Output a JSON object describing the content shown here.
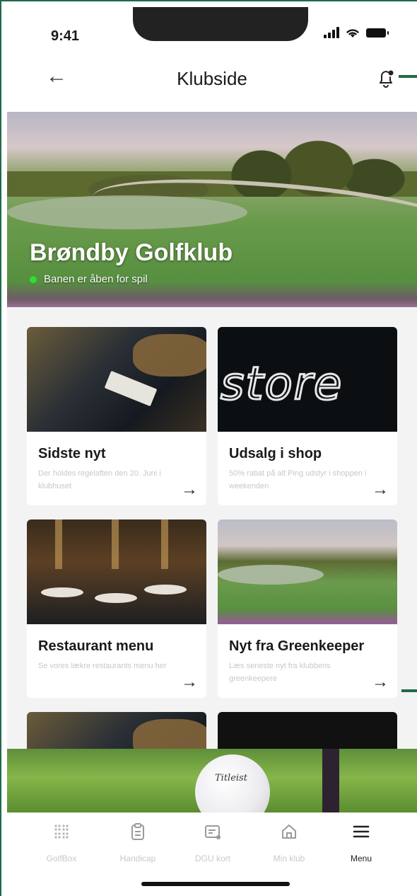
{
  "status_bar": {
    "time": "9:41"
  },
  "header": {
    "title": "Klubside",
    "back_icon": "arrow-left-icon",
    "notification_icon": "bell-icon"
  },
  "hero": {
    "club_name": "Brøndby Golfklub",
    "status_text": "Banen er åben for spil",
    "status_color": "#2ee02a"
  },
  "cards": [
    {
      "title": "Sidste nyt",
      "description": "Der holdes regelaften den 20. Juni i klubhuset",
      "arrow": "→"
    },
    {
      "title": "Udsalg i shop",
      "description": "50% rabat på alt Ping udstyr i shoppen i weekenden",
      "image_text": "store",
      "arrow": "→"
    },
    {
      "title": "Restaurant menu",
      "description": "Se vores lækre restaurants menu her",
      "arrow": "→"
    },
    {
      "title": "Nyt fra Greenkeeper",
      "description": "Læs seneste nyt fra klubbens greenkeepere",
      "arrow": "→"
    }
  ],
  "banner": {
    "ball_brand": "Titleist"
  },
  "nav": {
    "items": [
      {
        "label": "GolfBox",
        "icon": "grid-icon"
      },
      {
        "label": "Handicap",
        "icon": "clipboard-icon"
      },
      {
        "label": "DGU kort",
        "icon": "card-icon"
      },
      {
        "label": "Min klub",
        "icon": "home-icon"
      },
      {
        "label": "Menu",
        "icon": "menu-icon"
      }
    ]
  },
  "colors": {
    "brand_green": "#1f6b4a",
    "muted_text": "#c8c8c8"
  }
}
